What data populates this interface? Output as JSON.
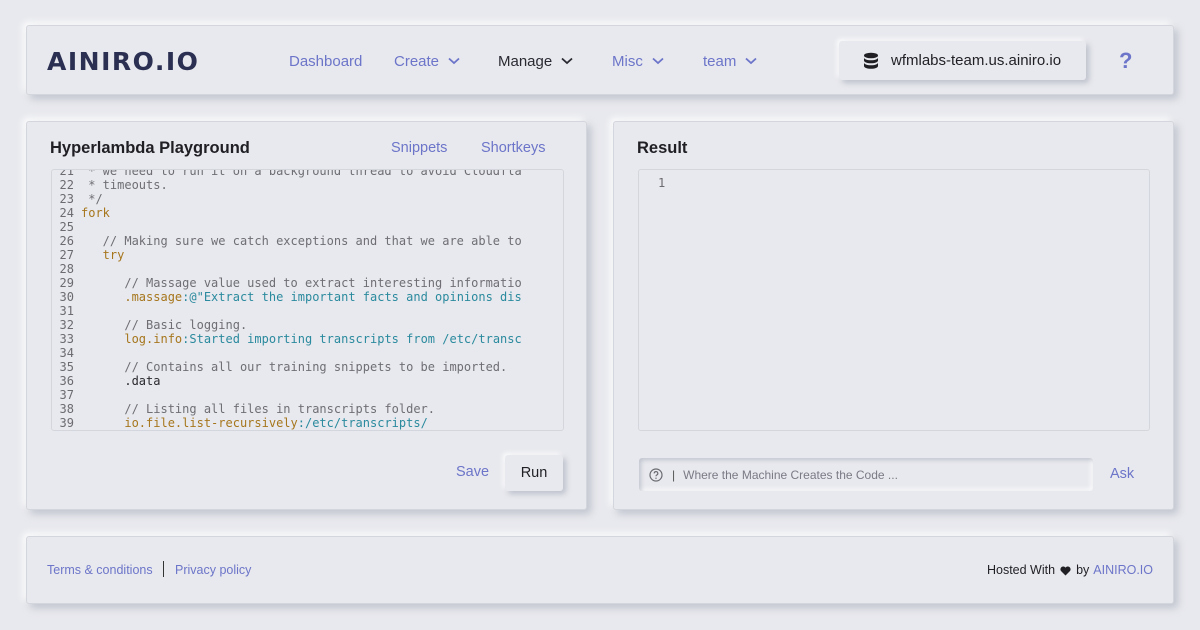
{
  "header": {
    "logo": "AINIRO.IO",
    "nav": [
      {
        "label": "Dashboard",
        "dropdown": false
      },
      {
        "label": "Create",
        "dropdown": true
      },
      {
        "label": "Manage",
        "dropdown": true,
        "active": true
      },
      {
        "label": "Misc",
        "dropdown": true
      },
      {
        "label": "team",
        "dropdown": true
      }
    ],
    "server": "wfmlabs-team.us.ainiro.io",
    "help": "?"
  },
  "playground": {
    "title": "Hyperlambda Playground",
    "snippets_label": "Snippets",
    "shortkeys_label": "Shortkeys",
    "save_label": "Save",
    "run_label": "Run",
    "code": [
      {
        "n": "21",
        "text": " * we need to run it on a background thread to avoid Cloudfla"
      },
      {
        "n": "22",
        "text": " * timeouts."
      },
      {
        "n": "23",
        "text": " */"
      },
      {
        "n": "24",
        "text": "fork"
      },
      {
        "n": "25",
        "text": ""
      },
      {
        "n": "26",
        "text": "   // Making sure we catch exceptions and that we are able to"
      },
      {
        "n": "27",
        "text": "   try"
      },
      {
        "n": "28",
        "text": ""
      },
      {
        "n": "29",
        "text": "      // Massage value used to extract interesting informatio"
      },
      {
        "n": "30",
        "key": "      .massage",
        "val": ":@\"Extract the important facts and opinions dis"
      },
      {
        "n": "31",
        "text": ""
      },
      {
        "n": "32",
        "text": "      // Basic logging."
      },
      {
        "n": "33",
        "key": "      log.info",
        "val": ":Started importing transcripts from /etc/transc"
      },
      {
        "n": "34",
        "text": ""
      },
      {
        "n": "35",
        "text": "      // Contains all our training snippets to be imported."
      },
      {
        "n": "36",
        "text": "      .data"
      },
      {
        "n": "37",
        "text": ""
      },
      {
        "n": "38",
        "text": "      // Listing all files in transcripts folder."
      },
      {
        "n": "39",
        "key": "      io.file.list-recursively",
        "val": ":/etc/transcripts/"
      }
    ]
  },
  "result": {
    "title": "Result",
    "line_number": "1",
    "ask_placeholder": "Where the Machine Creates the Code ...",
    "ask_separator": "|",
    "ask_label": "Ask"
  },
  "footer": {
    "terms": "Terms & conditions",
    "privacy": "Privacy policy",
    "hosted_prefix": "Hosted With",
    "hosted_by": "by",
    "brand": "AINIRO.IO"
  },
  "colors": {
    "background": "#e8e9ee",
    "accent": "#6c75c9",
    "logo": "#2b2f52",
    "code_keyword": "#a6761d",
    "code_value": "#2a8a9e"
  },
  "icons": {
    "server": "database-icon",
    "help": "question-mark-icon",
    "ask": "question-circle-icon",
    "heart": "heart-icon"
  }
}
